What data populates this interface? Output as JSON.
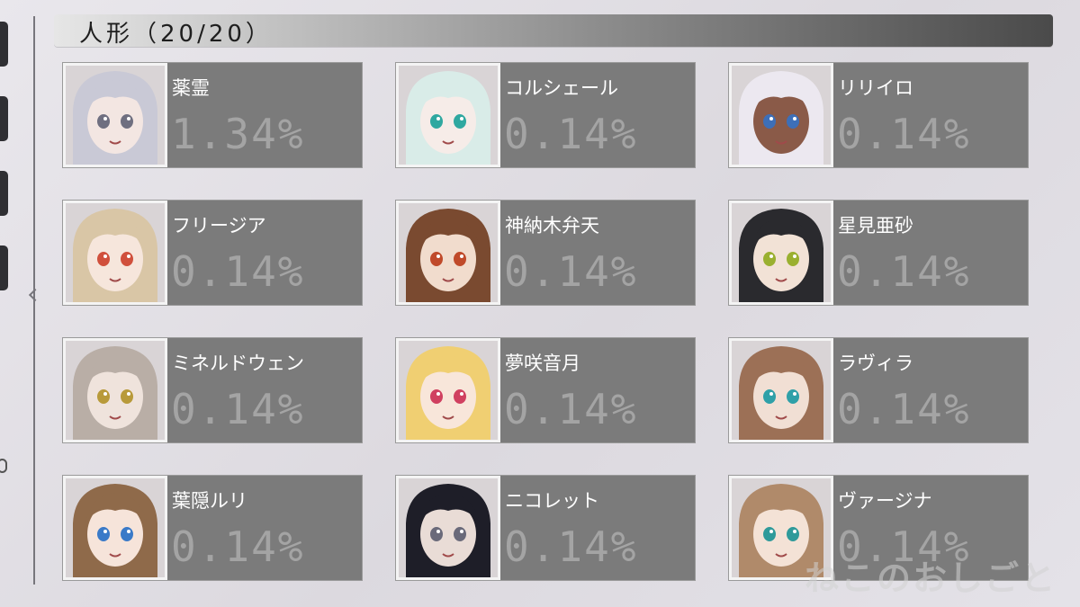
{
  "header": {
    "title": "人形（20/20）"
  },
  "characters": [
    {
      "name": "薬霊",
      "percent": "1.34%",
      "hair": "#c9c9d6",
      "skin": "#f3e6e2",
      "eyes": "#6f6f80"
    },
    {
      "name": "コルシェール",
      "percent": "0.14%",
      "hair": "#d9ece8",
      "skin": "#f6ece8",
      "eyes": "#2fa8a0"
    },
    {
      "name": "リリイロ",
      "percent": "0.14%",
      "hair": "#ece8f0",
      "skin": "#8a5a48",
      "eyes": "#3d6fb8"
    },
    {
      "name": "フリージア",
      "percent": "0.14%",
      "hair": "#d9c6a6",
      "skin": "#f6e6dc",
      "eyes": "#d0503c"
    },
    {
      "name": "神納木弁天",
      "percent": "0.14%",
      "hair": "#7a4a30",
      "skin": "#f1dccd",
      "eyes": "#c04a2a"
    },
    {
      "name": "星見亜砂",
      "percent": "0.14%",
      "hair": "#2a2a2e",
      "skin": "#f2e2d6",
      "eyes": "#9ab030"
    },
    {
      "name": "ミネルドウェン",
      "percent": "0.14%",
      "hair": "#b9aea6",
      "skin": "#efe3dc",
      "eyes": "#b89a3a"
    },
    {
      "name": "夢咲音月",
      "percent": "0.14%",
      "hair": "#f0cf72",
      "skin": "#f8e6da",
      "eyes": "#d04060"
    },
    {
      "name": "ラヴィラ",
      "percent": "0.14%",
      "hair": "#9c7056",
      "skin": "#f1dfd4",
      "eyes": "#2fa0a8"
    },
    {
      "name": "葉隠ルリ",
      "percent": "0.14%",
      "hair": "#8f6a4a",
      "skin": "#f6e4da",
      "eyes": "#3a7ac8"
    },
    {
      "name": "ニコレット",
      "percent": "0.14%",
      "hair": "#1e1e28",
      "skin": "#e9dcd6",
      "eyes": "#6a6a7a"
    },
    {
      "name": "ヴァージナ",
      "percent": "0.14%",
      "hair": "#b08a6a",
      "skin": "#f4e2d6",
      "eyes": "#2f9a9a"
    }
  ],
  "watermark": "ねこのおしごと"
}
